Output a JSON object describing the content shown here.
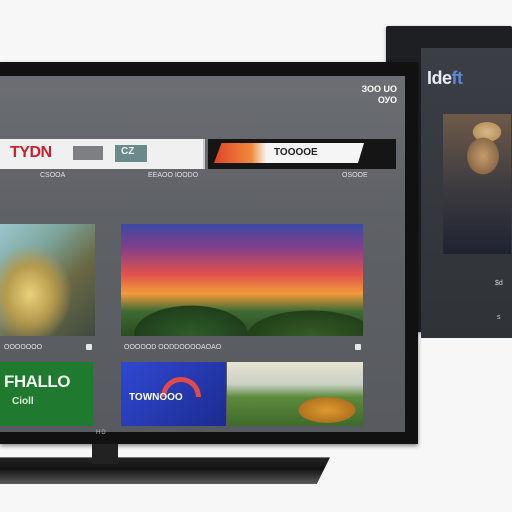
{
  "secondary_tv": {
    "logo_main": "Ide",
    "logo_accent": "ft",
    "label_1": "$d",
    "label_2": "s"
  },
  "main_tv": {
    "brand": "HD",
    "status": {
      "line1": "ЗОО UO",
      "line2": "ОУО"
    },
    "tiles": {
      "logo_word": "TYDN",
      "logo_chip": "CZ",
      "red_label": "TOOOOE"
    },
    "captions": {
      "row1_left": "CSOOA",
      "row1_mid": "EEAOO IOODO",
      "row1_right": "OSOOE",
      "row2_left": "OOOOOOO",
      "row2_mid": "OOOOOD OODDOOOOAOAO"
    },
    "bottom_tiles": {
      "green_title": "FHALLO",
      "green_sub": "Cioll",
      "blue_label": "TOWNOOO"
    }
  }
}
